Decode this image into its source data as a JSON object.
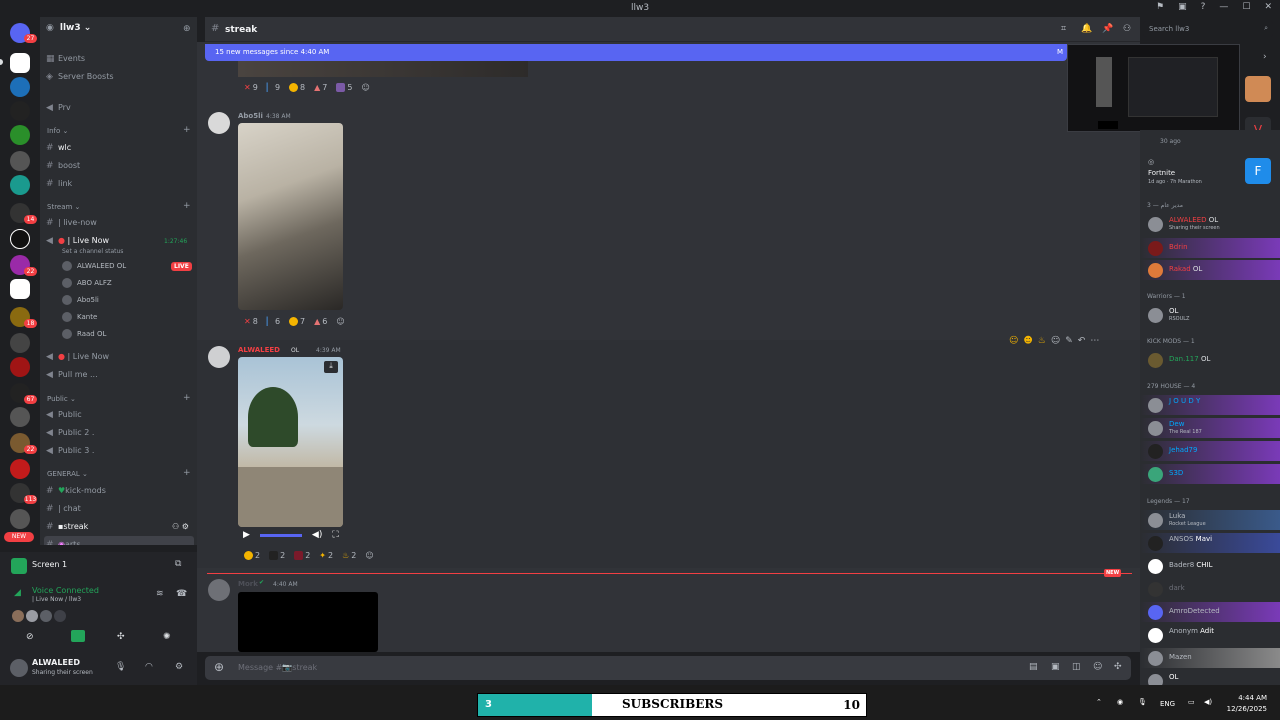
{
  "window": {
    "title": "llw3",
    "flag_icon": "flag-icon",
    "inbox_icon": "inbox-icon",
    "help_icon": "help-icon"
  },
  "server_rail": {
    "badges": [
      "27",
      "14",
      "22",
      "18",
      "67",
      "22",
      "113"
    ],
    "new_label": "NEW"
  },
  "sidebar": {
    "guild_name": "llw3",
    "items_top": [
      {
        "label": "Events"
      },
      {
        "label": "Server Boosts"
      }
    ],
    "prv": "Prv",
    "info_category": "Info",
    "info_channels": [
      "wlc",
      "boost",
      "link"
    ],
    "stream_category": "Stream",
    "stream_channels": [
      {
        "label": "| live-now"
      },
      {
        "label": "| Live Now",
        "status": "Set a channel status",
        "time": "1:27:46"
      }
    ],
    "voice_users": [
      {
        "name": "ALWALEED",
        "badge": "OL",
        "live": "LIVE"
      },
      {
        "name": "ABO ALFZ"
      },
      {
        "name": "Abo5li"
      },
      {
        "name": "Kante"
      },
      {
        "name": "Raad",
        "badge": "OL"
      }
    ],
    "voice_channels_more": [
      "| Live Now",
      "Pull me ..."
    ],
    "public_category": "Public",
    "public_channels": [
      "Public",
      "Public 2 .",
      "Public 3 ."
    ],
    "general_category": "GENERAL",
    "general_channels": [
      "kick-mods",
      "| chat",
      "streak",
      "arts"
    ]
  },
  "panel": {
    "screen_label": "Screen 1",
    "voice_connected": "Voice Connected",
    "voice_location": "| Live Now / llw3",
    "user_name": "ALWALEED",
    "user_status": "Sharing their screen"
  },
  "header": {
    "channel": "streak",
    "search_placeholder": "Search llw3"
  },
  "banner": {
    "text": "15 new messages since 4:40 AM",
    "mark": "M"
  },
  "messages": [
    {
      "reactions": [
        "9",
        "9",
        "8",
        "7",
        "5"
      ]
    },
    {
      "author": "Abo5li",
      "time": "4:38 AM",
      "reactions": [
        "8",
        "6",
        "7",
        "6"
      ]
    },
    {
      "author": "ALWALEED",
      "badge": "OL",
      "time": "4:39 AM",
      "reactions": [
        "2",
        "2",
        "2",
        "2",
        "2"
      ]
    },
    {
      "author": "Mork",
      "time": "4:40 AM"
    }
  ],
  "new_marker": "NEW",
  "message_input": {
    "placeholder": "Message #📷streak"
  },
  "members": {
    "top_activity_time": "30 ago",
    "fortnite": {
      "title": "Fortnite",
      "meta": "1d ago · 7h Marathon"
    },
    "cat1": "مدير عام — 3",
    "g1": [
      {
        "name": "ALWALEED",
        "badge": "OL",
        "status": "Sharing their screen",
        "color": "#f23f43"
      },
      {
        "name": "Bdrin",
        "color": "#f23f43"
      },
      {
        "name": "Rakad",
        "badge": "OL",
        "color": "#f23f43"
      }
    ],
    "cat2": "Warriors — 1",
    "g2": [
      {
        "name": "",
        "badge": "OL",
        "status": "RSOULZ",
        "color": "#f2f3f5"
      }
    ],
    "cat3": "KICK MODS — 1",
    "g3": [
      {
        "name": "Dan.117",
        "badge": "OL",
        "color": "#23a55a"
      }
    ],
    "cat4": "279 HOUSE — 4",
    "g4": [
      {
        "name": "J O U D Y",
        "color": "#00a8fc"
      },
      {
        "name": "Dew",
        "status": "The Real 187",
        "color": "#00a8fc"
      },
      {
        "name": "Jehad79",
        "color": "#00a8fc"
      },
      {
        "name": "S3D",
        "color": "#00a8fc"
      }
    ],
    "cat5": "Legends — 17",
    "g5": [
      {
        "name": "Luka",
        "status": "Rocket League",
        "color": "#b5bac1"
      },
      {
        "name": "ANSOS",
        "badge": "Mavi",
        "color": "#b5bac1"
      },
      {
        "name": "Bader8",
        "badge": "CHIL",
        "color": "#b5bac1"
      },
      {
        "name": "dark",
        "color": "#b5bac1"
      },
      {
        "name": "AmroDetected",
        "color": "#b5bac1"
      },
      {
        "name": "Anonym",
        "badge": "Adit",
        "color": "#b5bac1"
      },
      {
        "name": "Mazen",
        "color": "#b5bac1"
      },
      {
        "name": "",
        "badge": "OL",
        "color": "#b5bac1"
      }
    ]
  },
  "taskbar": {
    "subs_left": "3",
    "subs_label": "SUBSCRIBERS",
    "subs_right": "10",
    "lang": "ENG",
    "time": "4:44 AM",
    "date": "12/26/2025"
  }
}
